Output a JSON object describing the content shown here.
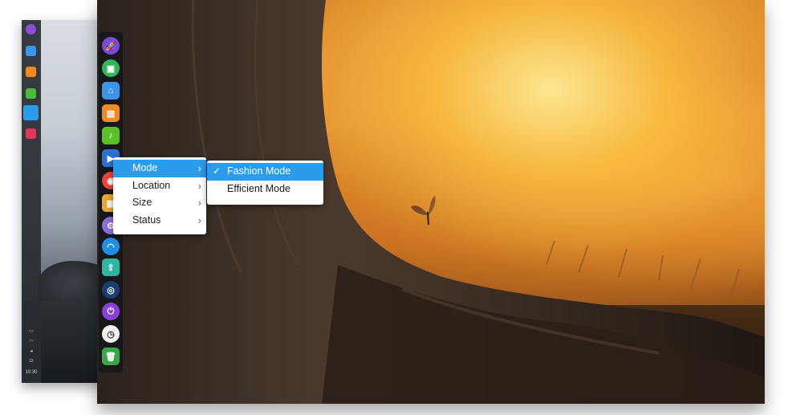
{
  "context_menu": {
    "items": [
      {
        "label": "Mode"
      },
      {
        "label": "Location"
      },
      {
        "label": "Size"
      },
      {
        "label": "Status"
      }
    ],
    "arrow_glyph": "›"
  },
  "mode_submenu": {
    "items": [
      {
        "label": "Fashion Mode",
        "checked": true
      },
      {
        "label": "Efficient Mode",
        "checked": false
      }
    ],
    "check_glyph": "✓"
  },
  "back_tray": {
    "time": "10:30"
  },
  "dock_icons": [
    "launcher-icon",
    "deepin-store-icon",
    "file-manager-icon",
    "app-store-icon",
    "music-icon",
    "movie-icon",
    "chrome-icon",
    "gallery-icon",
    "settings-icon",
    "network-icon",
    "usb-icon",
    "screenshot-icon",
    "power-icon",
    "clock-icon",
    "trash-icon"
  ],
  "colors": {
    "menu_highlight": "#2b9bec",
    "dock_background": "#14161a"
  }
}
